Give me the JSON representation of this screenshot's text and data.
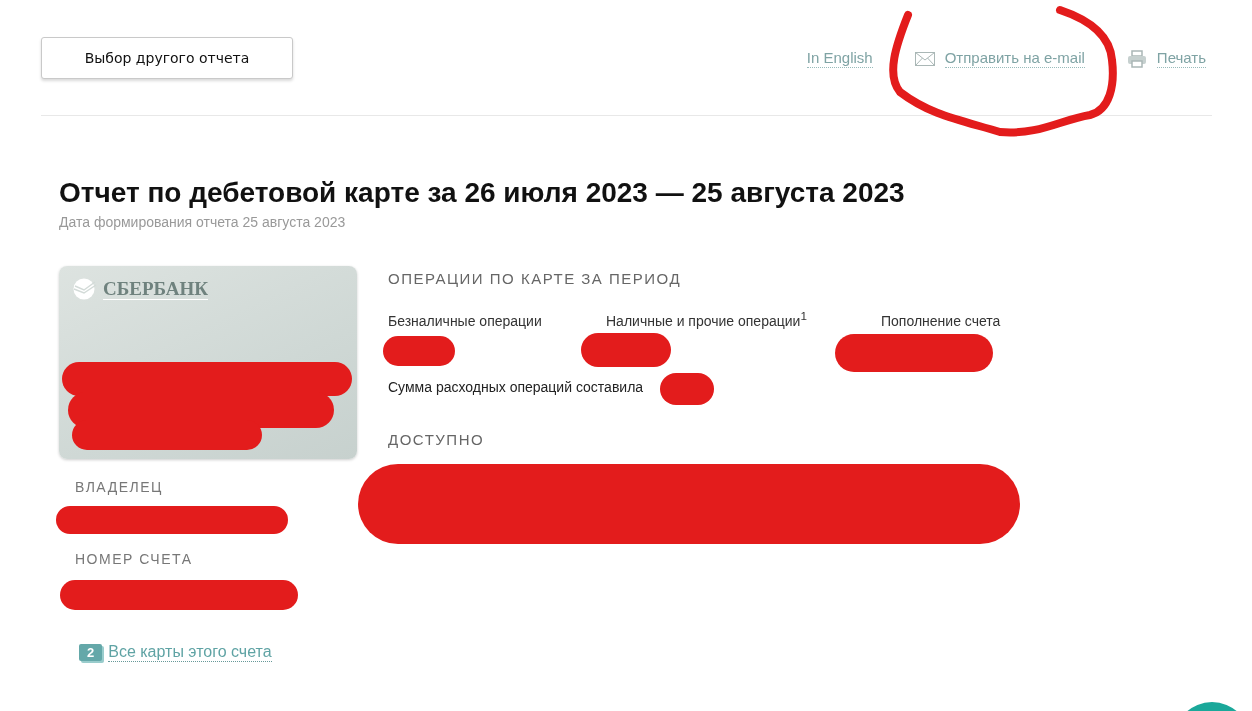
{
  "header": {
    "report_button": "Выбор другого отчета",
    "links": [
      {
        "kind": "plain",
        "label": "In English"
      },
      {
        "kind": "email",
        "label": "Отправить на e-mail"
      },
      {
        "kind": "print",
        "label": "Печать"
      }
    ]
  },
  "report": {
    "title": "Отчет по дебетовой карте за 26 июля 2023 — 25 августа 2023",
    "subtitle": "Дата формирования отчета 25 августа 2023"
  },
  "card": {
    "bank_logo": "СБЕРБАНК",
    "owner_label": "ВЛАДЕЛЕЦ",
    "account_label": "НОМЕР СЧЕТА",
    "cards_count": "2",
    "cards_link": "Все карты этого счета"
  },
  "operations": {
    "heading": "ОПЕРАЦИИ ПО КАРТЕ ЗА ПЕРИОД",
    "columns": [
      {
        "label": "Безналичные операции"
      },
      {
        "label": "Наличные и прочие операции$^{1}$"
      },
      {
        "label": "Пополнение счета"
      }
    ],
    "total_label": "Сумма расходных операций составила",
    "available_label": "ДОСТУПНО"
  }
}
